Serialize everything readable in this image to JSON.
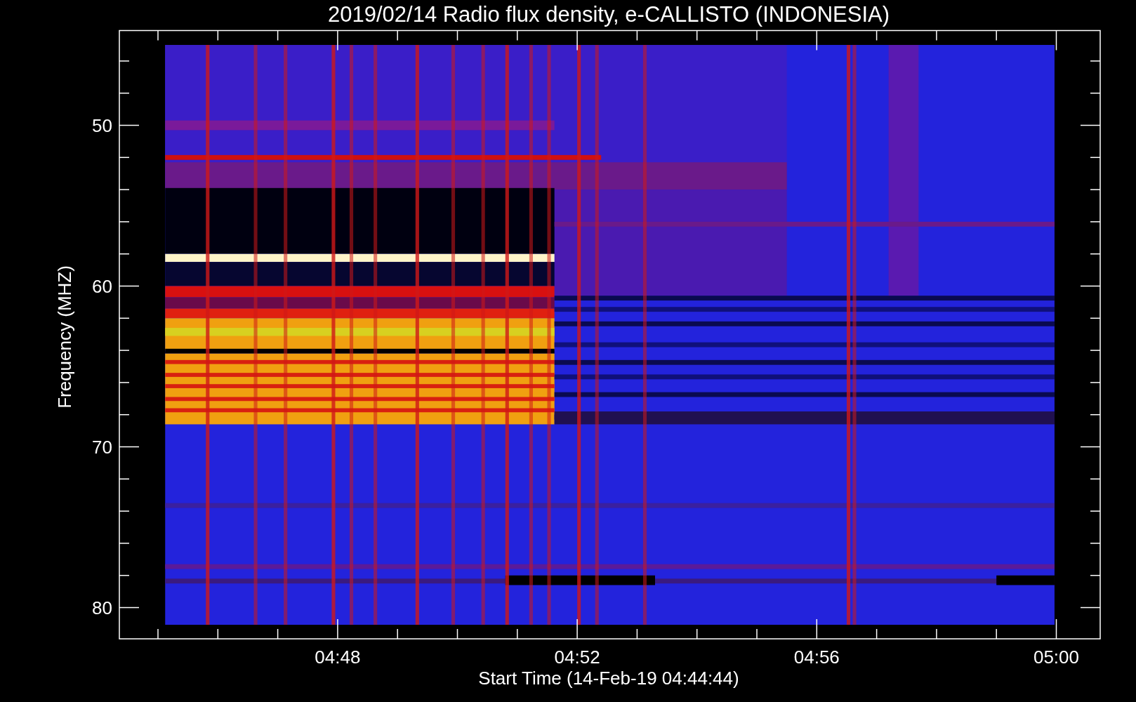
{
  "title": "2019/02/14  Radio flux density, e-CALLISTO (INDONESIA)",
  "plot": {
    "ylabel": "Frequency (MHZ)",
    "xlabel": "Start Time (14-Feb-19 04:44:44)",
    "yticks": [
      {
        "label": "50"
      },
      {
        "label": "60"
      },
      {
        "label": "70"
      },
      {
        "label": "80"
      }
    ],
    "xticks": [
      {
        "label": "04:48"
      },
      {
        "label": "04:52"
      },
      {
        "label": "04:56"
      },
      {
        "label": "05:00"
      }
    ]
  }
}
